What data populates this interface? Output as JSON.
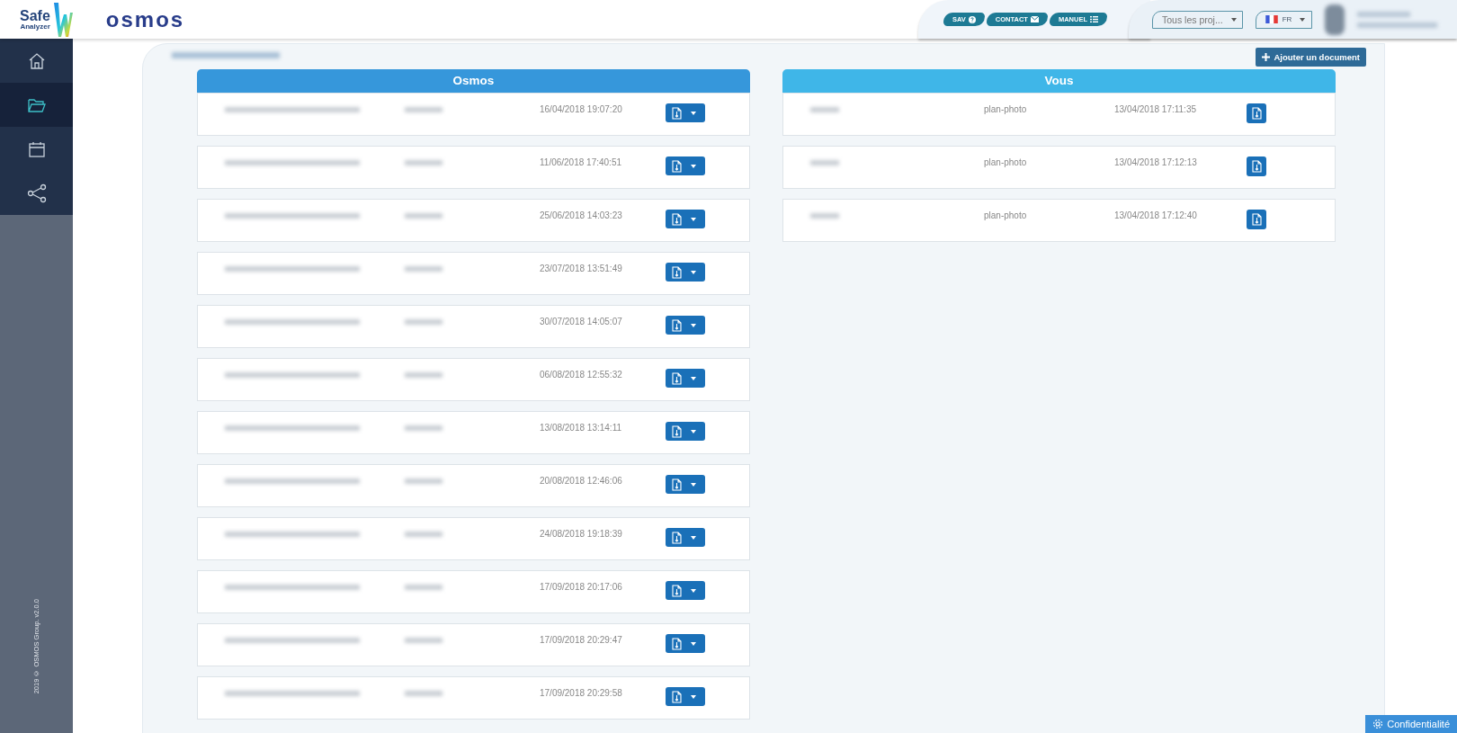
{
  "header": {
    "logo_top": "Safe",
    "logo_bottom": "Analyzer",
    "brand": "osmos",
    "links": [
      {
        "label": "SAV",
        "kind": "help"
      },
      {
        "label": "CONTACT",
        "kind": "mail"
      },
      {
        "label": "MANUEL",
        "kind": "list"
      }
    ],
    "project_select": {
      "value": "Tous les proj..."
    },
    "language": {
      "value": "FR"
    }
  },
  "sidebar": {
    "items": [
      {
        "kind": "home",
        "selected": false
      },
      {
        "kind": "folder",
        "selected": true
      },
      {
        "kind": "calendar",
        "selected": false
      },
      {
        "kind": "share",
        "selected": false
      }
    ],
    "footer": "2019 © OSMOS Group. v2.0.0"
  },
  "add_button": "Ajouter un document",
  "tables": [
    {
      "title": "Osmos",
      "kind": "split",
      "rows": [
        {
          "date": "16/04/2018 19:07:20"
        },
        {
          "date": "11/06/2018 17:40:51"
        },
        {
          "date": "25/06/2018 14:03:23"
        },
        {
          "date": "23/07/2018 13:51:49"
        },
        {
          "date": "30/07/2018 14:05:07"
        },
        {
          "date": "06/08/2018 12:55:32"
        },
        {
          "date": "13/08/2018 13:14:11"
        },
        {
          "date": "20/08/2018 12:46:06"
        },
        {
          "date": "24/08/2018 19:18:39"
        },
        {
          "date": "17/09/2018 20:17:06"
        },
        {
          "date": "17/09/2018 20:29:47"
        },
        {
          "date": "17/09/2018 20:29:58"
        }
      ]
    },
    {
      "title": "Vous",
      "kind": "single",
      "rows": [
        {
          "type": "plan-photo",
          "date": "13/04/2018 17:11:35"
        },
        {
          "type": "plan-photo",
          "date": "13/04/2018 17:12:13"
        },
        {
          "type": "plan-photo",
          "date": "13/04/2018 17:12:40"
        }
      ]
    }
  ],
  "privacy_button": "Confidentialité"
}
